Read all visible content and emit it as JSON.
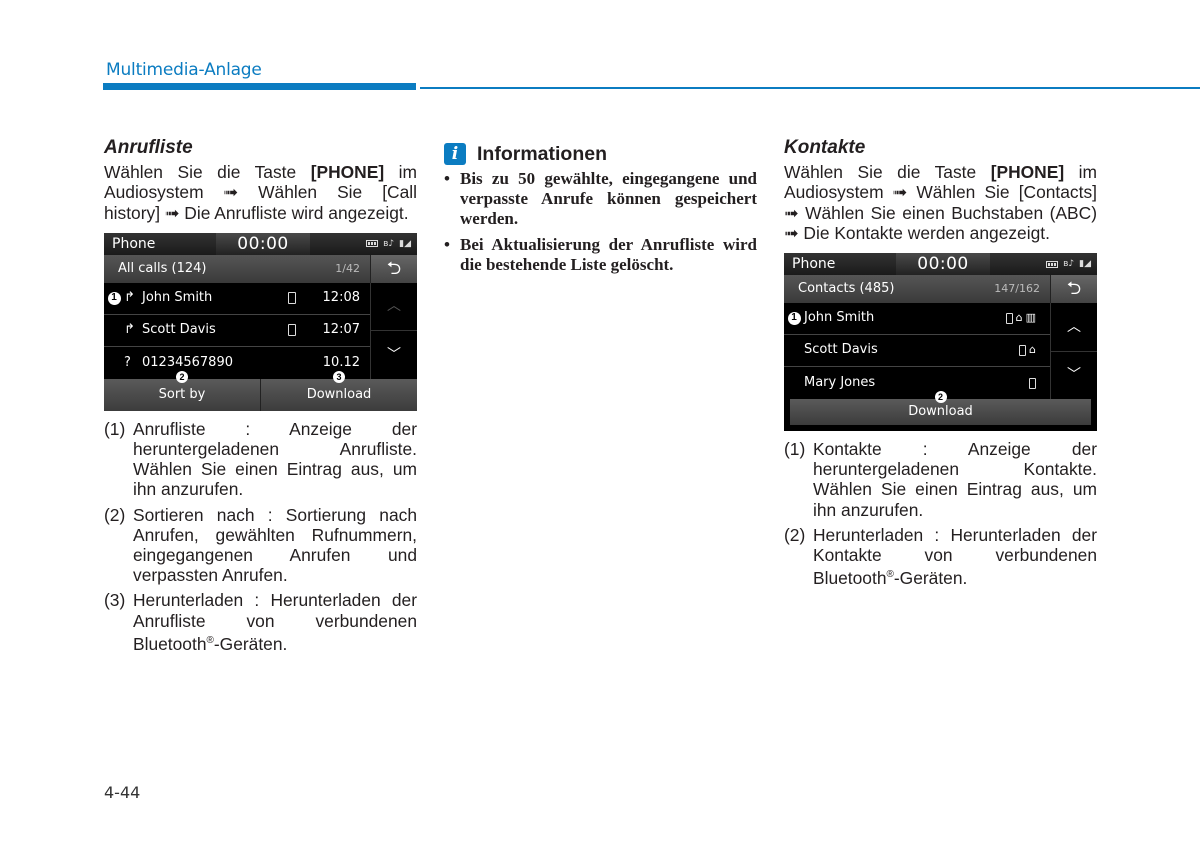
{
  "header": {
    "title": "Multimedia-Anlage",
    "accent_color": "#0b7cc1"
  },
  "call_history": {
    "title": "Anrufliste",
    "intro_pre": "Wählen Sie die Taste ",
    "intro_bold": "[PHONE]",
    "intro_post": " im Audiosystem ➟ Wählen Sie [Call history] ➟ Die Anrufliste wird angezeigt.",
    "screen": {
      "app": "Phone",
      "clock": "00:00",
      "list_title": "All calls (124)",
      "page": "1/42",
      "rows": [
        {
          "marker": "1",
          "type_icon": "outgoing-call-icon",
          "type_glyph": "↱",
          "name": "John Smith",
          "has_phone": true,
          "time": "12:08"
        },
        {
          "marker": "",
          "type_icon": "outgoing-call-icon",
          "type_glyph": "↱",
          "name": "Scott Davis",
          "has_phone": true,
          "time": "12:07"
        },
        {
          "marker": "",
          "type_icon": "missed-call-icon",
          "type_glyph": "?",
          "name": "01234567890",
          "has_phone": false,
          "time": "10.12"
        }
      ],
      "buttons": [
        {
          "label": "Sort by",
          "marker": "2"
        },
        {
          "label": "Download",
          "marker": "3"
        }
      ]
    },
    "items": [
      {
        "num": "(1)",
        "text": "Anrufliste : Anzeige der heruntergeladenen Anrufliste. Wählen Sie einen Eintrag aus, um ihn anzurufen."
      },
      {
        "num": "(2)",
        "text": "Sortieren nach : Sortierung nach Anrufen, gewählten Rufnummern, eingegangenen Anrufen und verpassten Anrufen."
      },
      {
        "num": "(3)",
        "text_pre": "Herunterladen : Herunterladen der Anrufliste von verbundenen Bluetooth",
        "sup": "®",
        "text_post": "-Geräten."
      }
    ]
  },
  "info": {
    "icon": "i",
    "title": "Informationen",
    "bullets": [
      "Bis zu 50 gewählte, eingegangene und verpasste Anrufe können gespeichert werden.",
      "Bei Aktualisierung der Anrufliste wird die bestehende Liste gelöscht."
    ]
  },
  "contacts": {
    "title": "Kontakte",
    "intro_pre": "Wählen Sie die Taste ",
    "intro_bold": "[PHONE]",
    "intro_post": " im Audiosystem ➟ Wählen Sie [Contacts] ➟ Wählen Sie einen Buchstaben (ABC) ➟ Die Kontakte werden angezeigt.",
    "screen": {
      "app": "Phone",
      "clock": "00:00",
      "list_title": "Contacts (485)",
      "page": "147/162",
      "rows": [
        {
          "marker": "1",
          "name": "John Smith",
          "icons": [
            "mobile",
            "home",
            "office"
          ]
        },
        {
          "marker": "",
          "name": "Scott Davis",
          "icons": [
            "mobile",
            "home"
          ]
        },
        {
          "marker": "",
          "name": "Mary Jones",
          "icons": [
            "mobile"
          ]
        }
      ],
      "button": {
        "label": "Download",
        "marker": "2"
      }
    },
    "items": [
      {
        "num": "(1)",
        "text": "Kontakte : Anzeige der heruntergeladenen Kontakte. Wählen Sie einen Eintrag aus, um ihn anzurufen."
      },
      {
        "num": "(2)",
        "text_pre": "Herunterladen : Herunterladen der Kontakte von verbundenen Bluetooth",
        "sup": "®",
        "text_post": "-Geräten."
      }
    ]
  },
  "page_number": "4-44"
}
